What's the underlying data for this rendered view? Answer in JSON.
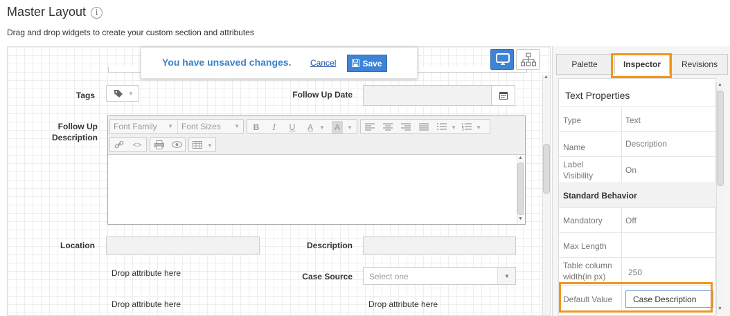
{
  "header": {
    "title": "Master Layout",
    "info_icon": "i",
    "subtitle": "Drag and drop widgets to create your custom section and attributes"
  },
  "banner": {
    "message": "You have unsaved changes.",
    "cancel_label": "Cancel",
    "save_label": "Save"
  },
  "form": {
    "tags_label": "Tags",
    "follow_up_date_label": "Follow Up Date",
    "follow_up_desc_label_1": "Follow Up",
    "follow_up_desc_label_2": "Description",
    "location_label": "Location",
    "description_label": "Description",
    "drop_1": "Drop attribute here",
    "case_source_label": "Case Source",
    "case_source_placeholder": "Select one",
    "drop_2": "Drop attribute here",
    "drop_3": "Drop attribute here"
  },
  "editor": {
    "font_family": "Font Family",
    "font_sizes": "Font Sizes",
    "bold": "B",
    "italic": "I",
    "underline": "U",
    "font_color": "A",
    "bg_color": "A"
  },
  "panel": {
    "tabs": [
      "Palette",
      "Inspector",
      "Revisions"
    ],
    "title": "Text Properties",
    "rows": [
      {
        "key": "Type",
        "value": "Text"
      },
      {
        "key": "Name",
        "value": "Description"
      },
      {
        "key1": "Label",
        "key2": "Visibility",
        "value": "On"
      },
      {
        "section": "Standard Behavior"
      },
      {
        "key": "Mandatory",
        "value": "Off"
      },
      {
        "key": "Max Length",
        "value": ""
      },
      {
        "key1": "Table column",
        "key2": "width(in px)",
        "value": "250"
      },
      {
        "key": "Default Value",
        "value": "Case Description"
      }
    ]
  },
  "colors": {
    "accent": "#3d84d6",
    "highlight": "#f0961e"
  }
}
